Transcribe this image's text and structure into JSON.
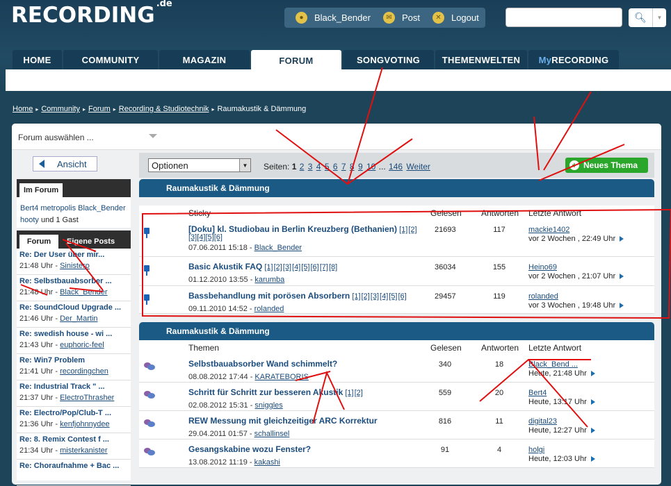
{
  "header": {
    "logo_main": "RECORDING",
    "logo_suffix": ".de",
    "user": "Black_Bender",
    "post": "Post",
    "logout": "Logout"
  },
  "nav": {
    "tabs": [
      "HOME",
      "COMMUNITY",
      "MAGAZIN",
      "FORUM",
      "SONGVOTING",
      "THEMENWELTEN",
      "MyRECORDING"
    ],
    "active": "FORUM"
  },
  "breadcrumb": [
    "Home",
    "Community",
    "Forum",
    "Recording & Studiotechnik",
    "Raumakustik & Dämmung"
  ],
  "forum_select": "Forum auswählen ...",
  "sidebar": {
    "ansicht": "Ansicht",
    "im_forum_title": "Im Forum",
    "users_line1": "Bert4  metropolis  Black_Bender",
    "users_name": "hooty",
    "users_guest": " und 1 Gast",
    "tab_forum": "Forum",
    "tab_eigene": "Eigene Posts",
    "posts": [
      {
        "title": "Re: Der User über mir...",
        "time": "21:48 Uhr - ",
        "user": "Sinistero"
      },
      {
        "title": "Re: Selbstbauabsorber ...",
        "time": "21:48 Uhr - ",
        "user": "Black_Bender"
      },
      {
        "title": "Re: SoundCloud Upgrade ...",
        "time": "21:46 Uhr - ",
        "user": "Der_Martin"
      },
      {
        "title": "Re: swedish house - wi ...",
        "time": "21:43 Uhr - ",
        "user": "euphoric-feel"
      },
      {
        "title": "Re: Win7 Problem",
        "time": "21:41 Uhr - ",
        "user": "recordingchen"
      },
      {
        "title": "Re: Industrial Track \" ...",
        "time": "21:37 Uhr - ",
        "user": "ElectroThrasher"
      },
      {
        "title": "Re: Electro/Pop/Club-T ...",
        "time": "21:36 Uhr - ",
        "user": "kenfjohnnydee"
      },
      {
        "title": "Re: 8. Remix Contest f ...",
        "time": "21:34 Uhr - ",
        "user": "misterkanister"
      },
      {
        "title": "Re: Choraufnahme + Bac ...",
        "time": "",
        "user": ""
      }
    ]
  },
  "toolbar": {
    "optionen": "Optionen",
    "seiten_label": "Seiten:",
    "current_page": "1",
    "pages": [
      "2",
      "3",
      "4",
      "5",
      "6",
      "7",
      "8",
      "9",
      "10",
      "...",
      "146"
    ],
    "weiter": "Weiter",
    "new_thread": "Neues Thema"
  },
  "section_title": "Raumakustik & Dämmung",
  "sticky_header": {
    "topic": "Sticky",
    "read": "Gelesen",
    "replies": "Antworten",
    "last": "Letzte Antwort"
  },
  "sticky": [
    {
      "title": "[Doku] kl. Studiobau in Berlin Kreuzberg (Bethanien)",
      "pages1": "[1] [2]",
      "pages2": "[3] [4] [5] [6]",
      "date": "07.06.2011 15:18 - ",
      "author": "Black_Bender",
      "read": "21693",
      "replies": "117",
      "last_user": "mackie1402",
      "last_time": "vor 2 Wochen , 22:49 Uhr"
    },
    {
      "title": "Basic Akustik FAQ",
      "pages1": "[1] [2] [3] [4] [5] [6] [7] [8]",
      "pages2": "",
      "date": "01.12.2010 13:55 - ",
      "author": "karumba",
      "read": "36034",
      "replies": "155",
      "last_user": "Heino69",
      "last_time": "vor 2 Wochen , 21:07 Uhr"
    },
    {
      "title": "Bassbehandlung mit porösen Absorbern",
      "pages1": "[1] [2] [3] [4] [5] [6]",
      "pages2": "",
      "date": "09.11.2010 14:52 - ",
      "author": "rolanded",
      "read": "29457",
      "replies": "119",
      "last_user": "rolanded",
      "last_time": "vor 3 Wochen , 19:48 Uhr"
    }
  ],
  "topics_header": {
    "topic": "Themen",
    "read": "Gelesen",
    "replies": "Antworten",
    "last": "Letzte Antwort"
  },
  "topics": [
    {
      "title": "Selbstbauabsorber Wand schimmelt?",
      "pages1": "",
      "date": "08.08.2012 17:44 - ",
      "author": "KARATEBORIS",
      "read": "340",
      "replies": "18",
      "last_user": "Black_Bend ...",
      "last_time": "Heute, 21:48 Uhr"
    },
    {
      "title": "Schritt für Schritt zur besseren Akustik",
      "pages1": "[1] [2]",
      "date": "02.08.2012 15:31 - ",
      "author": "sniggles",
      "read": "559",
      "replies": "20",
      "last_user": "Bert4",
      "last_time": "Heute, 13:17 Uhr"
    },
    {
      "title": "REW Messung mit gleichzeitiger ARC Korrektur",
      "pages1": "",
      "date": "29.04.2011 01:57 - ",
      "author": "schallinsel",
      "read": "816",
      "replies": "11",
      "last_user": "digital23",
      "last_time": "Heute, 12:27 Uhr"
    },
    {
      "title": "Gesangskabine wozu Fenster?",
      "pages1": "",
      "date": "13.08.2012 11:19 - ",
      "author": "kakashi",
      "read": "91",
      "replies": "4",
      "last_user": "holgi",
      "last_time": "Heute, 12:03 Uhr"
    }
  ]
}
